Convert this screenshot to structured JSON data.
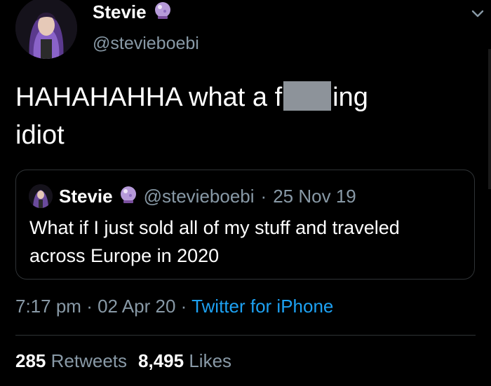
{
  "tweet": {
    "author": {
      "name": "Stevie",
      "handle": "@stevieboebi",
      "badge_icon": "crystal-ball-emoji"
    },
    "text_before": "HAHAHAHHA what a f",
    "text_after": "ing",
    "text_line2": "idiot",
    "quoted": {
      "author_name": "Stevie",
      "author_handle": "@stevieboebi",
      "separator": "·",
      "date": "25 Nov 19",
      "text": "What if I just sold all of my stuff and traveled across Europe in 2020"
    },
    "meta": {
      "time": "7:17 pm",
      "separator": "·",
      "date": "02 Apr 20",
      "source": "Twitter for iPhone"
    },
    "stats": {
      "retweets_count": "285",
      "retweets_label": "Retweets",
      "likes_count": "8,495",
      "likes_label": "Likes"
    }
  },
  "colors": {
    "background": "#000000",
    "text": "#ffffff",
    "secondary": "#8899a6",
    "link": "#1da1f2",
    "border": "#2f3336",
    "censor": "#8d939a"
  }
}
